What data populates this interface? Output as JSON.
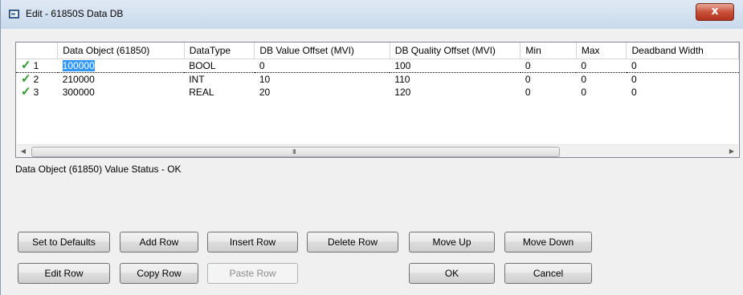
{
  "window": {
    "title": "Edit - 61850S Data DB",
    "close_label": "x"
  },
  "grid": {
    "columns": [
      "",
      "Data Object (61850)",
      "DataType",
      "DB Value Offset (MVI)",
      "DB Quality Offset (MVI)",
      "Min",
      "Max",
      "Deadband Width"
    ],
    "rows": [
      {
        "index": "1",
        "data_object": "100000",
        "datatype": "BOOL",
        "db_value_offset": "0",
        "db_quality_offset": "100",
        "min": "0",
        "max": "0",
        "deadband_width": "0",
        "valid": true
      },
      {
        "index": "2",
        "data_object": "210000",
        "datatype": "INT",
        "db_value_offset": "10",
        "db_quality_offset": "110",
        "min": "0",
        "max": "0",
        "deadband_width": "0",
        "valid": true
      },
      {
        "index": "3",
        "data_object": "300000",
        "datatype": "REAL",
        "db_value_offset": "20",
        "db_quality_offset": "120",
        "min": "0",
        "max": "0",
        "deadband_width": "0",
        "valid": true
      }
    ],
    "check_glyph": "✓",
    "scroll_grip": "III",
    "scroll_left_arrow": "◀",
    "scroll_right_arrow": "▶"
  },
  "status_text": "Data Object (61850) Value Status - OK",
  "buttons": {
    "set_to_defaults": "Set to Defaults",
    "add_row": "Add Row",
    "insert_row": "Insert Row",
    "delete_row": "Delete Row",
    "move_up": "Move Up",
    "move_down": "Move Down",
    "edit_row": "Edit Row",
    "copy_row": "Copy Row",
    "paste_row": "Paste Row",
    "ok": "OK",
    "cancel": "Cancel"
  },
  "colors": {
    "selection": "#3399ff",
    "check": "#2c9a2c",
    "close_button": "#c9503a"
  }
}
